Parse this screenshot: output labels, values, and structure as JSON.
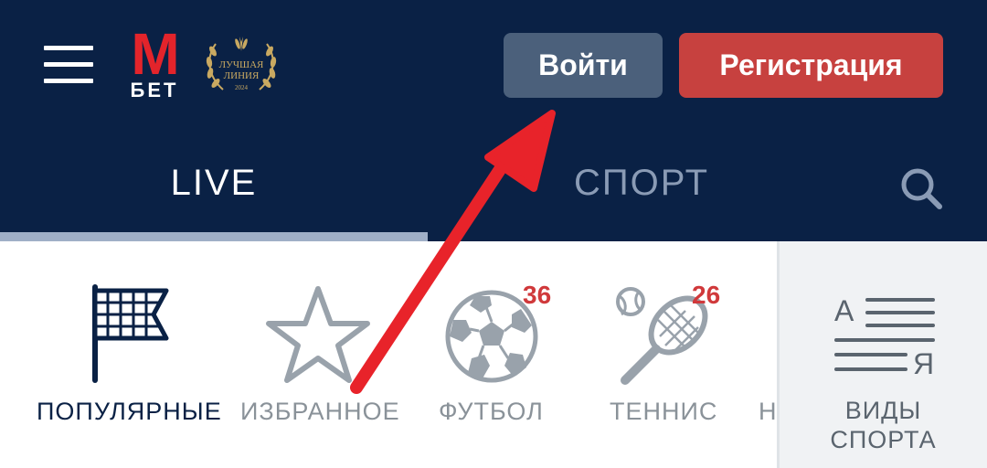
{
  "header": {
    "logo": {
      "letter": "M",
      "word": "БЕТ"
    },
    "award": {
      "line1": "ЛУЧШАЯ",
      "line2": "ЛИНИЯ",
      "year": "2024"
    },
    "login_label": "Войти",
    "register_label": "Регистрация",
    "colors": {
      "background": "#0a2145",
      "login": "#4b607b",
      "register": "#c7413f",
      "logo_red": "#e3242b"
    }
  },
  "tabs": [
    {
      "label": "LIVE",
      "active": true
    },
    {
      "label": "СПОРТ",
      "active": false
    }
  ],
  "categories": [
    {
      "label": "ПОПУЛЯРНЫЕ",
      "icon": "flag-icon"
    },
    {
      "label": "ИЗБРАННОЕ",
      "icon": "star-icon"
    },
    {
      "label": "ФУТБОЛ",
      "icon": "soccer-ball-icon",
      "badge": "36"
    },
    {
      "label": "ТЕННИС",
      "icon": "tennis-racket-icon",
      "badge": "26"
    },
    {
      "label": "Н",
      "icon": ""
    }
  ],
  "sports_panel": {
    "label_line1": "ВИДЫ",
    "label_line2": "СПОРТА",
    "icon_letters": {
      "top": "А",
      "bottom": "Я"
    }
  },
  "annotation": {
    "icon": "red-arrow-icon",
    "color": "#e8232a"
  }
}
